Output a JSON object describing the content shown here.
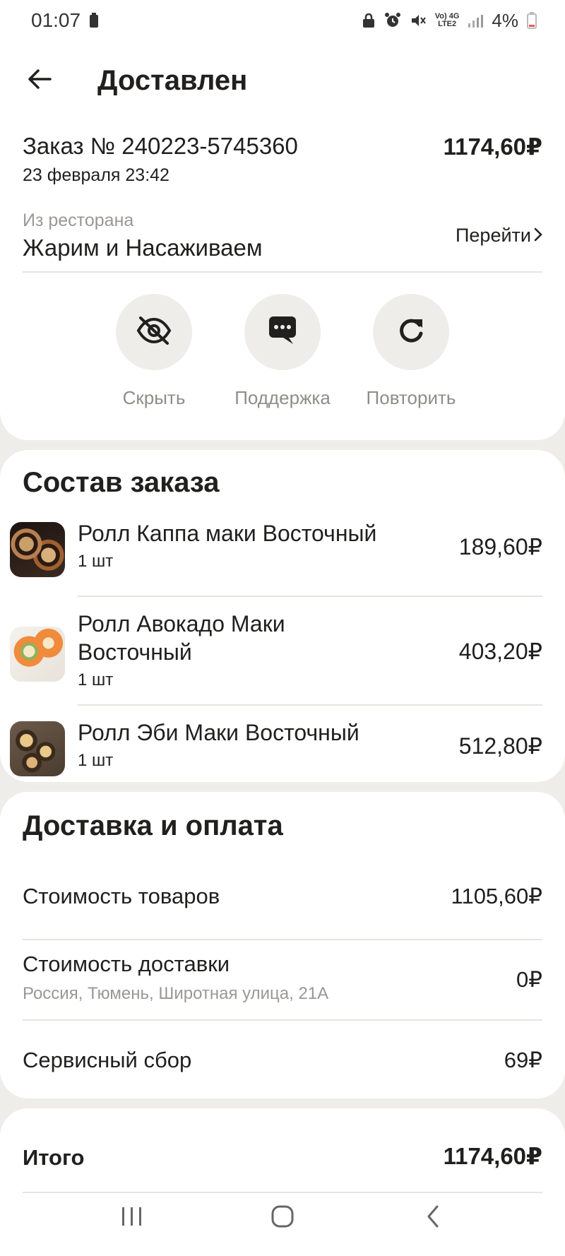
{
  "status_bar": {
    "time": "01:07",
    "network_top": "Vo) 4G",
    "network_bottom": "LTE2",
    "battery": "4%"
  },
  "header": {
    "title": "Доставлен"
  },
  "order": {
    "number_label": "Заказ № 240223-5745360",
    "date": "23 февраля 23:42",
    "amount": "1174,60₽",
    "restaurant_label": "Из ресторана",
    "restaurant_name": "Жарим и Насаживаем",
    "go_label": "Перейти"
  },
  "actions": [
    {
      "label": "Скрыть",
      "icon": "eye-off-icon"
    },
    {
      "label": "Поддержка",
      "icon": "chat-bubble-icon"
    },
    {
      "label": "Повторить",
      "icon": "refresh-icon"
    }
  ],
  "items_section": {
    "title": "Состав заказа",
    "items": [
      {
        "name": "Ролл Каппа маки Восточный",
        "qty": "1 шт",
        "price": "189,60₽"
      },
      {
        "name": "Ролл Авокадо Маки Восточный",
        "qty": "1 шт",
        "price": "403,20₽"
      },
      {
        "name": "Ролл Эби Маки Восточный",
        "qty": "1 шт",
        "price": "512,80₽"
      }
    ]
  },
  "delivery_section": {
    "title": "Доставка и оплата",
    "goods_label": "Стоимость товаров",
    "goods_value": "1105,60₽",
    "delivery_label": "Стоимость доставки",
    "delivery_address": "Россия, Тюмень, Широтная улица, 21А",
    "delivery_value": "0₽",
    "service_label": "Сервисный сбор",
    "service_value": "69₽"
  },
  "total": {
    "label": "Итого",
    "value": "1174,60₽"
  },
  "colors": {
    "background": "#efedea",
    "card": "#ffffff",
    "text": "#21201f",
    "muted": "#9a9895"
  }
}
